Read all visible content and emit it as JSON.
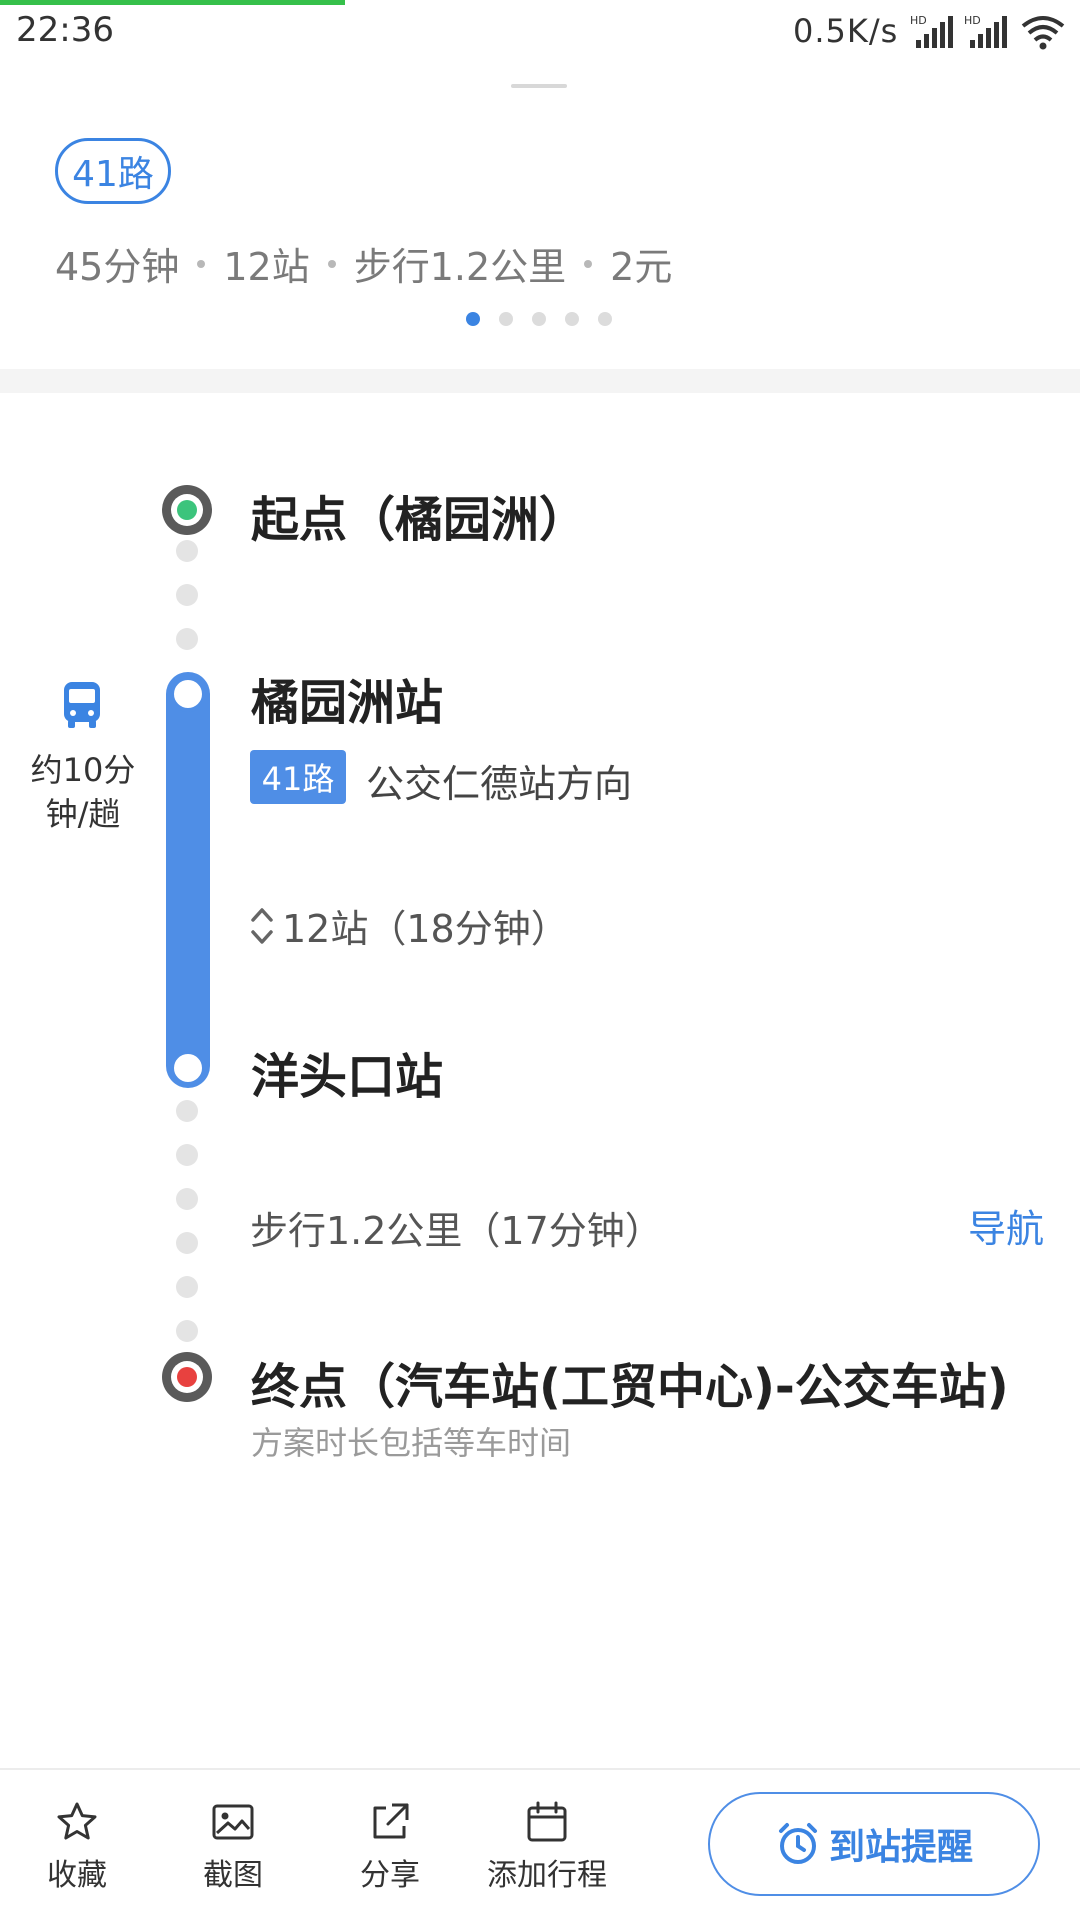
{
  "status_bar": {
    "time": "22:36",
    "network_speed": "0.5K/s"
  },
  "route_summary": {
    "line_badge": "41路",
    "duration": "45分钟",
    "stops": "12站",
    "walk": "步行1.2公里",
    "fare": "2元",
    "pager": {
      "count": 5,
      "active_index": 0
    }
  },
  "timeline": {
    "start": {
      "label": "起点（橘园洲）"
    },
    "board_stop": {
      "name": "橘园洲站"
    },
    "bus": {
      "line_tag": "41路",
      "direction": "公交仁德站方向",
      "ride_summary": "12站（18分钟）",
      "frequency": "约10分钟/趟"
    },
    "alight_stop": {
      "name": "洋头口站"
    },
    "walk": {
      "text": "步行1.2公里（17分钟）",
      "nav_label": "导航"
    },
    "end": {
      "label": "终点（汽车站(工贸中心)-公交车站)"
    },
    "note": "方案时长包括等车时间"
  },
  "bottom_bar": {
    "favorite_label": "收藏",
    "screenshot_label": "截图",
    "share_label": "分享",
    "add_trip_label": "添加行程",
    "arrival_alert_label": "到站提醒"
  },
  "colors": {
    "accent": "#3b84e2",
    "bus_line": "#4f8ee6",
    "start_dot": "#3cc47c",
    "end_dot": "#e8413f"
  }
}
